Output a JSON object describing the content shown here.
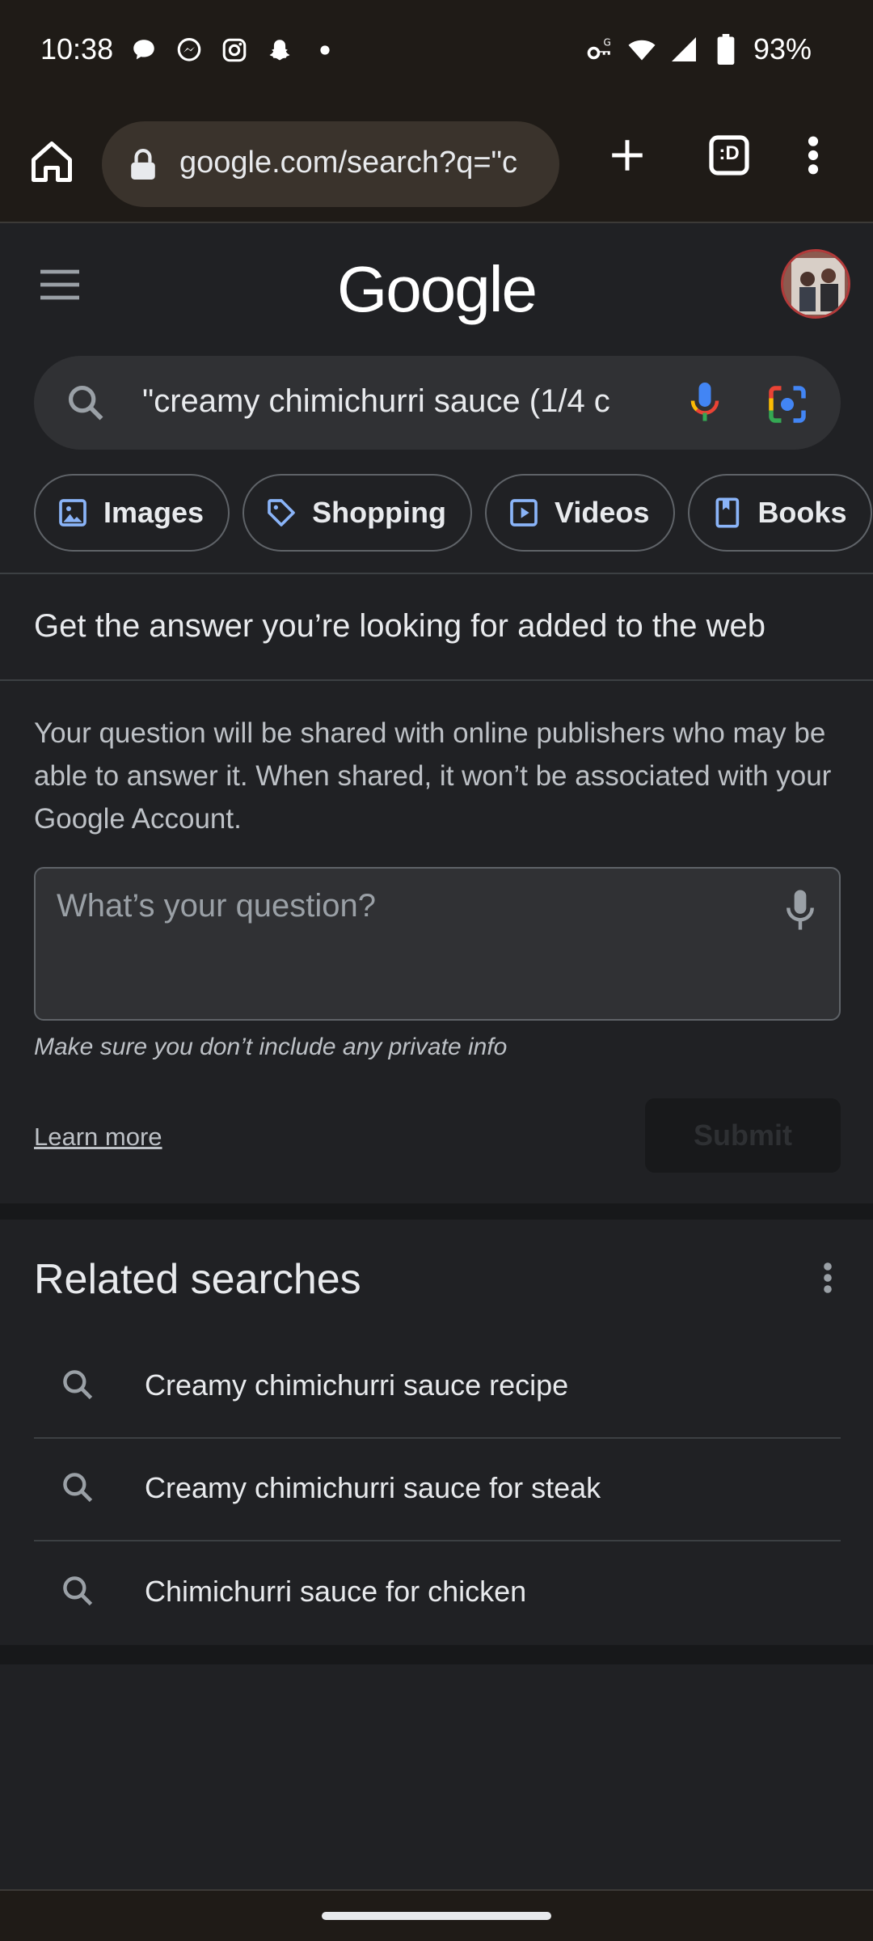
{
  "status_bar": {
    "time": "10:38",
    "battery": "93%",
    "icons": [
      "chat-bubble-icon",
      "messenger-icon",
      "instagram-icon",
      "snapchat-icon",
      "dot-icon",
      "vpn-key-icon",
      "wifi-icon",
      "signal-icon",
      "battery-icon"
    ]
  },
  "browser": {
    "url": "google.com/search?q=\"c",
    "tab_count": ":D"
  },
  "google": {
    "logo": "Google",
    "search_query": "\"creamy chimichurri sauce (1/4 c"
  },
  "chips": [
    {
      "label": "Images",
      "icon": "image-icon"
    },
    {
      "label": "Shopping",
      "icon": "tag-icon"
    },
    {
      "label": "Videos",
      "icon": "play-icon"
    },
    {
      "label": "Books",
      "icon": "book-icon"
    }
  ],
  "ask": {
    "title": "Get the answer you’re looking for added to the web",
    "description": "Your question will be shared with online publishers who may be able to answer it. When shared, it won’t be associated with your Google Account.",
    "placeholder": "What’s your question?",
    "privacy_note": "Make sure you don’t include any private info",
    "learn_more": "Learn more",
    "submit": "Submit"
  },
  "related": {
    "title": "Related searches",
    "items": [
      "Creamy chimichurri sauce recipe",
      "Creamy chimichurri sauce for steak",
      "Chimichurri sauce for chicken"
    ]
  },
  "colors": {
    "background": "#202124",
    "browser_chrome": "#1f1b17",
    "url_pill": "#3a332c",
    "search_box": "#303134",
    "text_primary": "#e8eaed",
    "text_secondary": "#bdc1c6",
    "accent_blue": "#8ab4f8"
  }
}
